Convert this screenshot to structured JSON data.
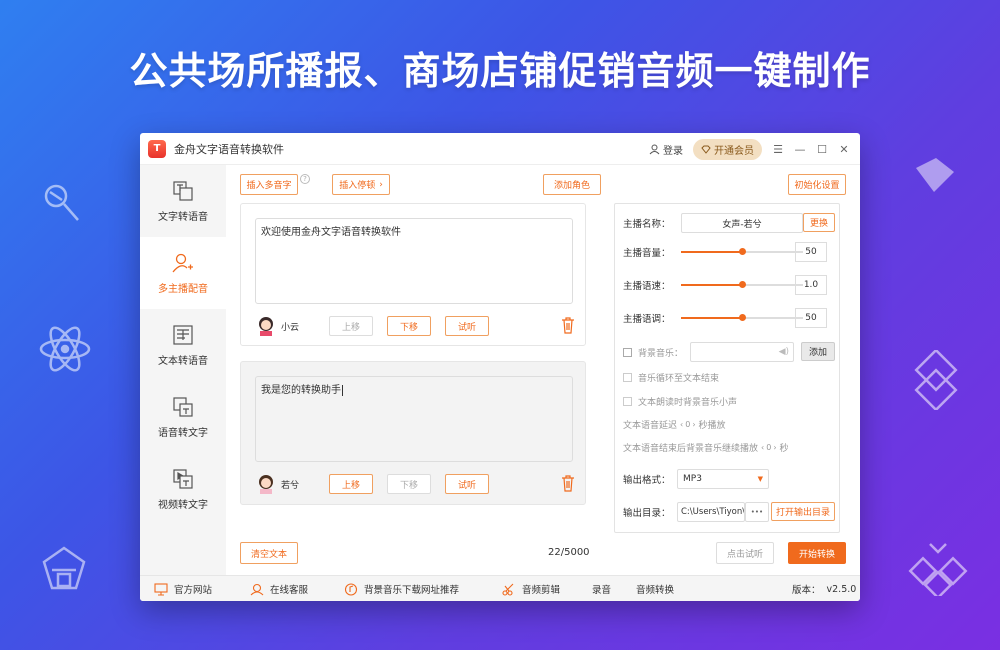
{
  "headline": "公共场所播报、商场店铺促销音频一键制作",
  "app": {
    "title": "金舟文字语音转换软件",
    "logo_text": "T",
    "login_label": "登录",
    "vip_label": "开通会员"
  },
  "sidebar": {
    "items": [
      {
        "label": "文字转语音",
        "icon": "text-to-speech-icon"
      },
      {
        "label": "多主播配音",
        "icon": "add-user-icon",
        "active": true
      },
      {
        "label": "文本转语音",
        "icon": "document-icon"
      },
      {
        "label": "语音转文字",
        "icon": "speech-to-text-icon"
      },
      {
        "label": "视频转文字",
        "icon": "video-to-text-icon"
      }
    ]
  },
  "toolbar": {
    "insert_polyphone": "插入多音字",
    "insert_pause": "插入停顿",
    "add_role": "添加角色",
    "init_settings": "初始化设置"
  },
  "segments": [
    {
      "text": "欢迎使用金舟文字语音转换软件",
      "voice": "小云",
      "up": "上移",
      "down": "下移",
      "listen": "试听",
      "up_enabled": false,
      "down_enabled": true
    },
    {
      "text": "我是您的转换助手",
      "voice": "若兮",
      "up": "上移",
      "down": "下移",
      "listen": "试听",
      "up_enabled": true,
      "down_enabled": false
    }
  ],
  "clear_text": "清空文本",
  "char_count": "22/5000",
  "settings": {
    "anchor_name_label": "主播名称：",
    "anchor_name_value": "女声-若兮",
    "change_label": "更换",
    "volume_label": "主播音量：",
    "volume_value": "50",
    "volume_level": 0.5,
    "speed_label": "主播语速：",
    "speed_value": "1.0",
    "speed_level": 0.5,
    "pitch_label": "主播语调：",
    "pitch_value": "50",
    "pitch_level": 0.5,
    "bgm_label": "背景音乐：",
    "add_label": "添加",
    "loop_label": "音乐循环至文本结束",
    "duck_label": "文本朗读时背景音乐小声",
    "delay_prefix": "文本语音延迟",
    "delay_value": "0",
    "delay_suffix": "秒播放",
    "continue_prefix": "文本语音结束后背景音乐继续播放",
    "continue_value": "0",
    "continue_suffix": "秒",
    "format_label": "输出格式：",
    "format_value": "MP3",
    "dir_label": "输出目录：",
    "dir_value": "C:\\Users\\Tiyon\\",
    "dir_more": "•••",
    "open_dir_label": "打开输出目录"
  },
  "preview_label": "点击试听",
  "convert_label": "开始转换",
  "footer": {
    "website": "官方网站",
    "service": "在线客服",
    "bgm_sites": "背景音乐下载网址推荐",
    "audio_cut": "音频剪辑",
    "record": "录音",
    "audio_convert": "音频转换",
    "version_label": "版本：",
    "version_value": "v2.5.0"
  },
  "colors": {
    "accent": "#f06a1d",
    "vip_bg": "#f3dfc2"
  }
}
